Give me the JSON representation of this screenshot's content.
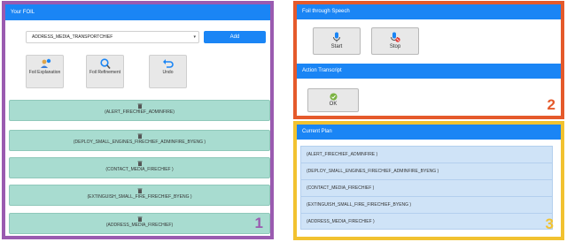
{
  "foil_panel": {
    "title": "Your FOIL",
    "select_value": "ADDRESS_MEDIA_TRANSPORTCHIEF",
    "add_label": "Add",
    "tools": [
      {
        "label": "Foil Explanation",
        "icon": "person-question-icon"
      },
      {
        "label": "Foil Refinement",
        "icon": "magnifier-icon"
      },
      {
        "label": "Undo",
        "icon": "undo-icon"
      }
    ],
    "actions": [
      "(ALERT_FIRECHIEF_ADMINFIRE)",
      "(DEPLOY_SMALL_ENGINES_FIRECHIEF_ADMINFIRE_BYENG )",
      "(CONTACT_MEDIA_FIRECHIEF )",
      "(EXTINGUISH_SMALL_FIRE_FIRECHIEF_BYENG )",
      "(ADDRESS_MEDIA_FIRECHIEF)"
    ],
    "badge": "1"
  },
  "speech_panel": {
    "title": "Foil through Speech",
    "start_label": "Start",
    "stop_label": "Stop",
    "transcript_title": "Action Transcript",
    "ok_label": "OK",
    "badge": "2"
  },
  "plan_panel": {
    "title": "Current Plan",
    "items": [
      "(ALERT_FIRECHIEF_ADMINFIRE )",
      "(DEPLOY_SMALL_ENGINES_FIRECHIEF_ADMINFIRE_BYENG )",
      "(CONTACT_MEDIA_FIRECHIEF )",
      "(EXTINGUISH_SMALL_FIRE_FIRECHIEF_BYENG )",
      "(ADDRESS_MEDIA_FIRECHIEF )"
    ],
    "badge": "3"
  },
  "colors": {
    "header_blue": "#1a85f5",
    "panel1_border": "#9a5bb0",
    "panel2_border": "#e55a2b",
    "panel3_border": "#f2c230",
    "action_teal": "#a8dcd0",
    "plan_blue": "#cfe3f7"
  }
}
